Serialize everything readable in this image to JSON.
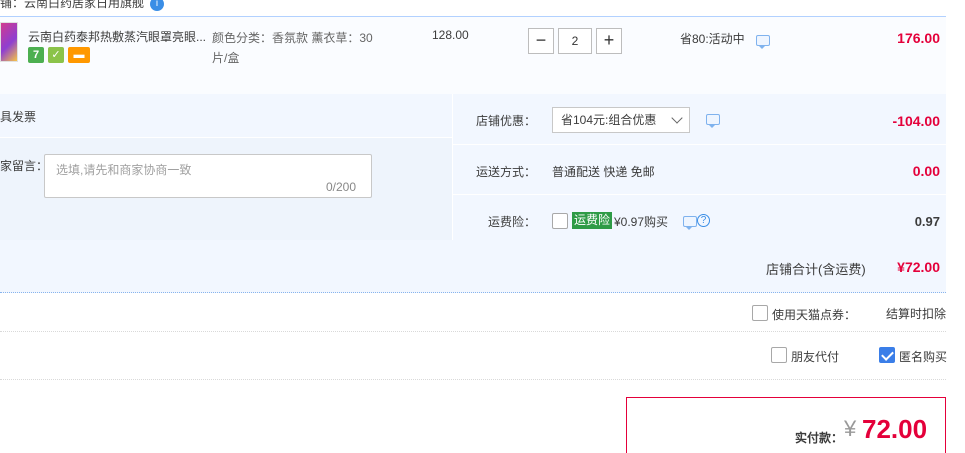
{
  "shop": {
    "name_line": "铺：云南白药居家日用旗舰",
    "info_icon": "info-icon"
  },
  "item": {
    "title": "云南白药泰邦热敷蒸汽眼罩亮眼...",
    "sku": "颜色分类：香氛款 薰衣草：30片/盒",
    "unit_price": "128.00",
    "quantity": "2",
    "minus_label": "−",
    "plus_label": "+",
    "discount": "省80:活动中",
    "total": "176.00",
    "badge_7": "7"
  },
  "options": {
    "invoice_label": "开具发票",
    "note_label": "给卖家留言：",
    "note_placeholder": "选填,请先和商家协商一致",
    "note_count": "0/200",
    "shop_discount_label": "店铺优惠：",
    "shop_discount_value": "省104元:组合优惠",
    "shop_discount_amount": "-104.00",
    "shipping_label": "运送方式：",
    "shipping_value": "普通配送 快递 免邮",
    "shipping_amount": "0.00",
    "insurance_label": "运费险：",
    "insurance_tag": "运费险",
    "insurance_text": "¥0.97购买",
    "insurance_amount": "0.97",
    "help_glyph": "?"
  },
  "shop_total": {
    "label": "店铺合计(含运费)",
    "amount": "¥72.00"
  },
  "bottom": {
    "tmall_points_label": "使用天猫点券：",
    "tmall_points_note": "结算时扣除",
    "friend_pay_label": "朋友代付",
    "anonymous_label": "匿名购买",
    "anonymous_checked": true
  },
  "payment": {
    "label": "实付款：",
    "currency": "¥",
    "amount": "72.00"
  },
  "colors": {
    "accent_red": "#e4003a",
    "accent_blue": "#3a7ee8",
    "row_bg": "#f2f7ff"
  }
}
